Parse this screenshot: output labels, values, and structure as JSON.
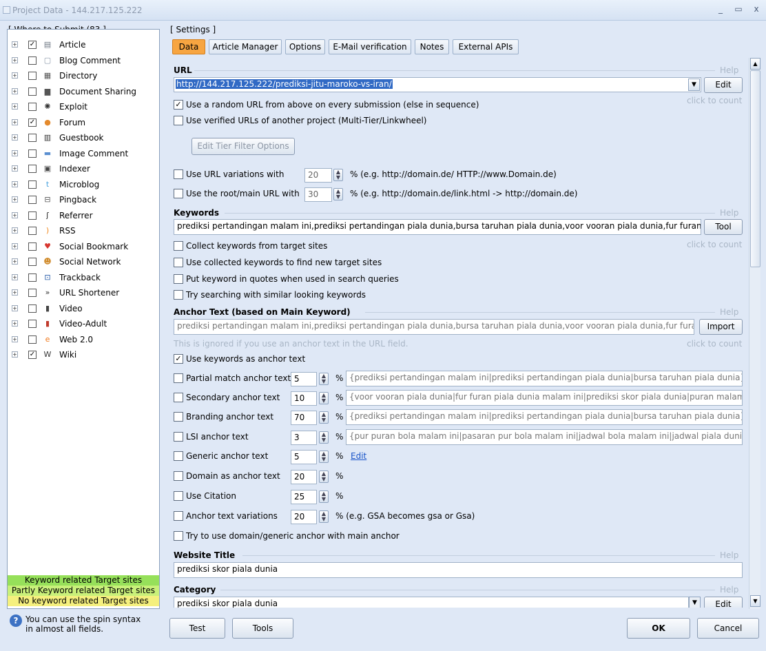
{
  "window": {
    "title": "Project Data - 144.217.125.222",
    "minimize": "_",
    "maximize": "▭",
    "close": "x"
  },
  "left": {
    "group_label": "[ Where to Submit  (83 ]",
    "items": [
      {
        "label": "Article",
        "checked": true,
        "icon": "article-icon",
        "glyph": "▤",
        "color": "#6a7480"
      },
      {
        "label": "Blog Comment",
        "checked": false,
        "icon": "blog-comment-icon",
        "glyph": "▢",
        "color": "#8a97a8"
      },
      {
        "label": "Directory",
        "checked": false,
        "icon": "directory-icon",
        "glyph": "▦",
        "color": "#555"
      },
      {
        "label": "Document Sharing",
        "checked": false,
        "icon": "document-sharing-icon",
        "glyph": "▆",
        "color": "#555"
      },
      {
        "label": "Exploit",
        "checked": false,
        "icon": "exploit-icon",
        "glyph": "✺",
        "color": "#333"
      },
      {
        "label": "Forum",
        "checked": true,
        "icon": "forum-icon",
        "glyph": "●",
        "color": "#e48a2d"
      },
      {
        "label": "Guestbook",
        "checked": false,
        "icon": "guestbook-icon",
        "glyph": "▥",
        "color": "#333"
      },
      {
        "label": "Image Comment",
        "checked": false,
        "icon": "image-comment-icon",
        "glyph": "▬",
        "color": "#5a8fd0"
      },
      {
        "label": "Indexer",
        "checked": false,
        "icon": "indexer-icon",
        "glyph": "▣",
        "color": "#444"
      },
      {
        "label": "Microblog",
        "checked": false,
        "icon": "microblog-icon",
        "glyph": "t",
        "color": "#4aa3df"
      },
      {
        "label": "Pingback",
        "checked": false,
        "icon": "pingback-icon",
        "glyph": "⊟",
        "color": "#555"
      },
      {
        "label": "Referrer",
        "checked": false,
        "icon": "referrer-icon",
        "glyph": "ʃ",
        "color": "#222"
      },
      {
        "label": "RSS",
        "checked": false,
        "icon": "rss-icon",
        "glyph": ")",
        "color": "#f28b20"
      },
      {
        "label": "Social Bookmark",
        "checked": false,
        "icon": "social-bookmark-icon",
        "glyph": "♥",
        "color": "#d7372f"
      },
      {
        "label": "Social Network",
        "checked": false,
        "icon": "social-network-icon",
        "glyph": "☻",
        "color": "#d08a2a"
      },
      {
        "label": "Trackback",
        "checked": false,
        "icon": "trackback-icon",
        "glyph": "⊡",
        "color": "#2358a7"
      },
      {
        "label": "URL Shortener",
        "checked": false,
        "icon": "url-shortener-icon",
        "glyph": "»",
        "color": "#333"
      },
      {
        "label": "Video",
        "checked": false,
        "icon": "video-icon",
        "glyph": "▮",
        "color": "#444"
      },
      {
        "label": "Video-Adult",
        "checked": false,
        "icon": "video-adult-icon",
        "glyph": "▮",
        "color": "#c0392b"
      },
      {
        "label": "Web 2.0",
        "checked": false,
        "icon": "web20-icon",
        "glyph": "e",
        "color": "#f07a1e"
      },
      {
        "label": "Wiki",
        "checked": true,
        "icon": "wiki-icon",
        "glyph": "W",
        "color": "#333"
      }
    ],
    "legend": [
      {
        "text": "Keyword related Target sites",
        "color": "#96e05a"
      },
      {
        "text": "Partly Keyword related Target sites",
        "color": "#c9f07a"
      },
      {
        "text": "No keyword related Target sites",
        "color": "#f5f07e"
      }
    ],
    "hint": "You can use the spin syntax in almost all fields."
  },
  "settings": {
    "group_label": "[ Settings ]",
    "tabs": [
      "Data",
      "Article Manager",
      "Options",
      "E-Mail verification",
      "Notes",
      "External APIs"
    ],
    "help": "Help",
    "click_to_count": "click to count",
    "url": {
      "heading": "URL",
      "value": "http://144.217.125.222/prediksi-jitu-maroko-vs-iran/",
      "edit": "Edit",
      "random": "Use a random URL from above on every submission (else in sequence)",
      "verified": "Use verified URLs of another project (Multi-Tier/Linkwheel)",
      "tier_filter": "Edit Tier Filter Options",
      "variations_label": "Use URL variations with",
      "variations_value": "20",
      "variations_note": "% (e.g. http://domain.de/ HTTP://www.Domain.de)",
      "root_label": "Use the root/main URL with",
      "root_value": "30",
      "root_note": "% (e.g. http://domain.de/link.html -> http://domain.de)"
    },
    "keywords": {
      "heading": "Keywords",
      "value": "prediksi pertandingan malam ini,prediksi pertandingan piala dunia,bursa taruhan piala dunia,voor vooran piala dunia,fur furan piala dunia malam ini",
      "tool": "Tool",
      "collect": "Collect keywords from target sites",
      "use_collected": "Use collected keywords to find new target sites",
      "quotes": "Put keyword in quotes when used in search queries",
      "similar": "Try searching with similar looking keywords"
    },
    "anchor": {
      "heading": "Anchor Text (based on Main Keyword)",
      "value": "prediksi pertandingan malam ini,prediksi pertandingan piala dunia,bursa taruhan piala dunia,voor vooran piala dunia,fur furan piala dunia malam ini",
      "import": "Import",
      "note": "This is ignored if you use an anchor text in the URL field.",
      "use_keywords": "Use keywords as anchor text",
      "rows": [
        {
          "label": "Partial match anchor text",
          "value": "5",
          "text": "{prediksi pertandingan malam ini|prediksi pertandingan piala dunia|bursa taruhan piala dunia}"
        },
        {
          "label": "Secondary anchor text",
          "value": "10",
          "text": "{voor vooran piala dunia|fur furan piala dunia malam ini|prediksi skor piala dunia|puran malam ini}"
        },
        {
          "label": "Branding anchor text",
          "value": "70",
          "text": "{prediksi pertandingan malam ini|prediksi pertandingan piala dunia|bursa taruhan piala dunia}{"
        },
        {
          "label": "LSI anchor text",
          "value": "3",
          "text": "{pur puran bola malam ini|pasaran pur bola malam ini|jadwal bola malam ini|jadwal piala dunia malam ini}"
        },
        {
          "label": "Generic anchor text",
          "value": "5",
          "text": "Edit"
        },
        {
          "label": "Domain as anchor text",
          "value": "20",
          "text": ""
        },
        {
          "label": "Use Citation",
          "value": "25",
          "text": ""
        },
        {
          "label": "Anchor text variations",
          "value": "20",
          "text": "% (e.g. GSA becomes gsa or Gsa)"
        }
      ],
      "try_domain": "Try to use domain/generic anchor with main anchor"
    },
    "website_title": {
      "heading": "Website Title",
      "value": "prediksi skor piala dunia"
    },
    "category": {
      "heading": "Category",
      "value": "prediksi skor piala dunia",
      "edit": "Edit"
    }
  },
  "footer": {
    "test": "Test",
    "tools": "Tools",
    "ok": "OK",
    "cancel": "Cancel"
  },
  "percent": "%"
}
